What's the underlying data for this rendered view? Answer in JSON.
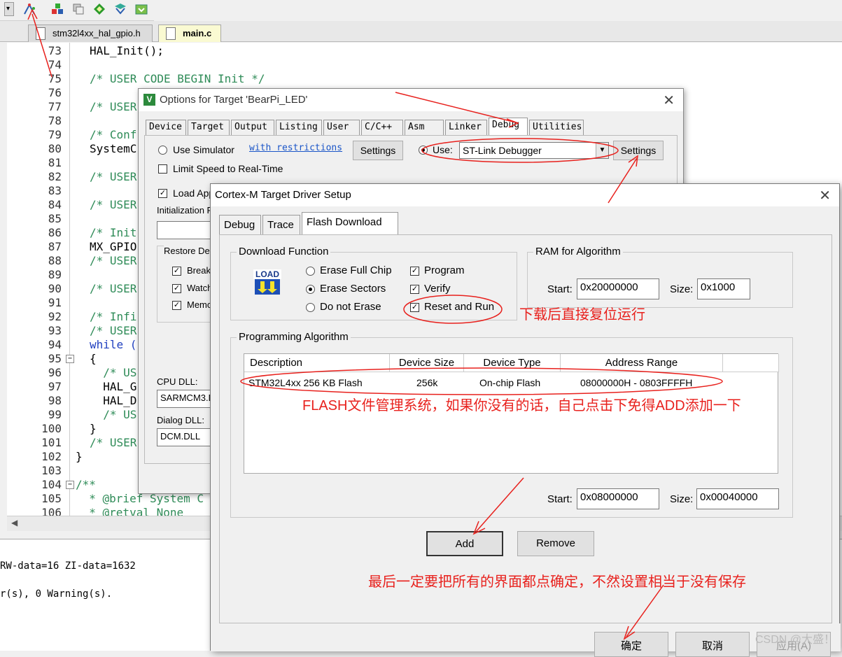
{
  "editor": {
    "tabs": [
      {
        "label": "stm32l4xx_hal_gpio.h"
      },
      {
        "label": "main.c"
      }
    ],
    "lines": [
      {
        "n": "73",
        "text": "HAL_Init();",
        "kind": "code"
      },
      {
        "n": "74",
        "text": "",
        "kind": "code"
      },
      {
        "n": "75",
        "text": "/* USER CODE BEGIN Init */",
        "kind": "comment"
      },
      {
        "n": "76",
        "text": "",
        "kind": "code"
      },
      {
        "n": "77",
        "text": "/* USER",
        "kind": "comment"
      },
      {
        "n": "78",
        "text": "",
        "kind": "code"
      },
      {
        "n": "79",
        "text": "/* Conf",
        "kind": "comment"
      },
      {
        "n": "80",
        "text": "SystemC",
        "kind": "code"
      },
      {
        "n": "81",
        "text": "",
        "kind": "code"
      },
      {
        "n": "82",
        "text": "/* USER",
        "kind": "comment"
      },
      {
        "n": "83",
        "text": "",
        "kind": "code"
      },
      {
        "n": "84",
        "text": "/* USER",
        "kind": "comment"
      },
      {
        "n": "85",
        "text": "",
        "kind": "code"
      },
      {
        "n": "86",
        "text": "/* Init",
        "kind": "comment"
      },
      {
        "n": "87",
        "text": "MX_GPIO",
        "kind": "code"
      },
      {
        "n": "88",
        "text": "/* USER",
        "kind": "comment"
      },
      {
        "n": "89",
        "text": "",
        "kind": "code"
      },
      {
        "n": "90",
        "text": "/* USER",
        "kind": "comment"
      },
      {
        "n": "91",
        "text": "",
        "kind": "code"
      },
      {
        "n": "92",
        "text": "/* Infi",
        "kind": "comment"
      },
      {
        "n": "93",
        "text": "/* USER",
        "kind": "comment"
      },
      {
        "n": "94",
        "text": "while (",
        "kind": "keyword"
      },
      {
        "n": "95",
        "text": "{",
        "kind": "code"
      },
      {
        "n": "96",
        "text": "  /* US",
        "kind": "comment"
      },
      {
        "n": "97",
        "text": "  HAL_G",
        "kind": "code"
      },
      {
        "n": "98",
        "text": "  HAL_D",
        "kind": "code"
      },
      {
        "n": "99",
        "text": "  /* US",
        "kind": "comment"
      },
      {
        "n": "100",
        "text": "}",
        "kind": "code"
      },
      {
        "n": "101",
        "text": "/* USER",
        "kind": "comment"
      },
      {
        "n": "102",
        "text": "}",
        "kind": "code0"
      },
      {
        "n": "103",
        "text": "",
        "kind": "code"
      },
      {
        "n": "104",
        "text": "/**",
        "kind": "comment0"
      },
      {
        "n": "105",
        "text": "  * @brief System C",
        "kind": "comment0"
      },
      {
        "n": "106",
        "text": "  * @retval None",
        "kind": "comment0"
      }
    ]
  },
  "output": {
    "lines": [
      "RW-data=16 ZI-data=1632",
      "",
      "r(s), 0 Warning(s)."
    ]
  },
  "options_dialog": {
    "title": "Options for Target 'BearPi_LED'",
    "tabs": [
      "Device",
      "Target",
      "Output",
      "Listing",
      "User",
      "C/C++",
      "Asm",
      "Linker",
      "Debug",
      "Utilities"
    ],
    "active_tab": "Debug",
    "use_simulator": "Use Simulator",
    "with_restrictions": "with restrictions",
    "settings_label": "Settings",
    "limit_speed": "Limit Speed to Real-Time",
    "use_label": "Use:",
    "debugger": "ST-Link Debugger",
    "load_app": "Load App",
    "init_file": "Initialization F",
    "restore": "Restore De",
    "restore_items": [
      "Break",
      "Watch",
      "Memo"
    ],
    "cpu_dll_label": "CPU DLL:",
    "cpu_dll_value": "SARMCM3.D",
    "dialog_dll_label": "Dialog DLL:",
    "dialog_dll_value": "DCM.DLL"
  },
  "driver_dialog": {
    "title": "Cortex-M Target Driver Setup",
    "tabs": [
      "Debug",
      "Trace",
      "Flash Download"
    ],
    "active_tab": "Flash Download",
    "download_function": {
      "title": "Download Function",
      "load_icon_text": "LOAD",
      "erase_options": [
        "Erase Full Chip",
        "Erase Sectors",
        "Do not Erase"
      ],
      "selected_erase": "Erase Sectors",
      "checks": [
        {
          "label": "Program",
          "checked": true
        },
        {
          "label": "Verify",
          "checked": true
        },
        {
          "label": "Reset and Run",
          "checked": true
        }
      ]
    },
    "ram": {
      "title": "RAM for Algorithm",
      "start_label": "Start:",
      "start": "0x20000000",
      "size_label": "Size:",
      "size": "0x1000"
    },
    "algorithm": {
      "title": "Programming Algorithm",
      "columns": [
        "Description",
        "Device Size",
        "Device Type",
        "Address Range"
      ],
      "rows": [
        {
          "description": "STM32L4xx 256 KB Flash",
          "size": "256k",
          "type": "On-chip Flash",
          "range": "08000000H - 0803FFFFH"
        }
      ],
      "start_label": "Start:",
      "start": "0x08000000",
      "size_label": "Size:",
      "size": "0x00040000"
    },
    "add_label": "Add",
    "remove_label": "Remove",
    "ok_label": "确定",
    "cancel_label": "取消",
    "apply_label": "应用(A)"
  },
  "annotations": {
    "reset_run": "下载后直接复位运行",
    "flash": "FLASH文件管理系统，如果你没有的话，自己点击下免得ADD添加一下",
    "save": "最后一定要把所有的界面都点确定，不然设置相当于没有保存"
  },
  "watermark": "CSDN @大盛！",
  "colors": {
    "annotation": "#e8211d",
    "comment": "#2e8b57",
    "keyword": "#1f3fbf"
  }
}
